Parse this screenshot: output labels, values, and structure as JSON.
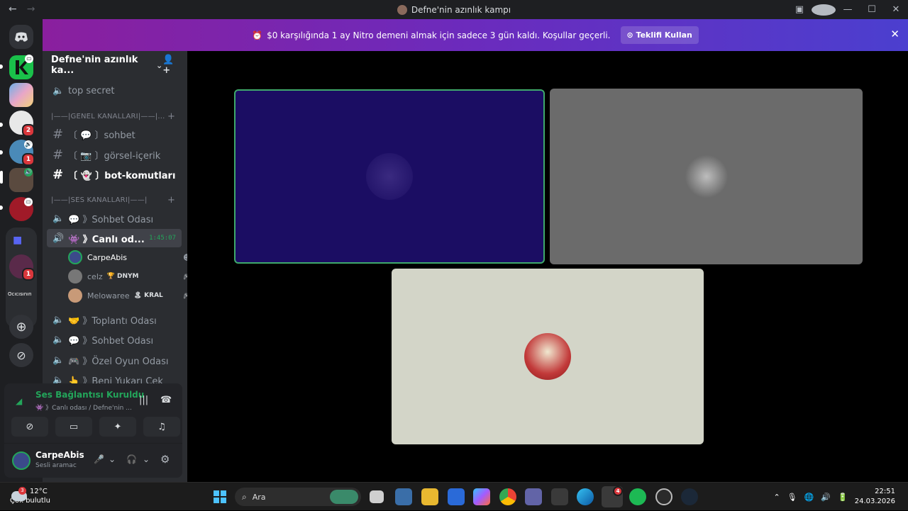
{
  "titlebar": {
    "title": "Defne'nin azınlık kampı",
    "back": "←",
    "forward": "→",
    "help": "?",
    "minimize": "—",
    "maximize": "☐",
    "close": "✕"
  },
  "rail": {
    "badges": {
      "s3": "2",
      "s4": "1",
      "folder": "1"
    },
    "folder_label": "Ocıcısının"
  },
  "nitro": {
    "icon": "⏰",
    "text": "$0 karşılığında 1 ay Nitro demeni almak için sadece 3 gün kaldı. Koşullar geçerli.",
    "button": "Teklifi Kullan",
    "close": "✕"
  },
  "server": {
    "name": "Defne'nin azınlık ka..."
  },
  "channels": {
    "top": "top secret",
    "cat1": "|——|GENEL KANALLARI|——|...",
    "text": [
      {
        "label": "〔 💬 〕sohbet"
      },
      {
        "label": "〔 📷 〕görsel-içerik"
      },
      {
        "label": "〔 👻 〕bot-komutları"
      }
    ],
    "cat2": "|——|SES KANALLARI|——|",
    "voice1": "💬 》Sohbet Odası",
    "live": {
      "label": "👾 》Canlı od...",
      "time": "1:45:07"
    },
    "members": [
      {
        "name": "CarpeAbis",
        "tag": ""
      },
      {
        "name": "celz",
        "tag": "🏆 DNYM"
      },
      {
        "name": "Melowaree",
        "tag": "🏝 KRAL"
      }
    ],
    "voice": [
      "🤝 》Toplantı Odası",
      "💬 》Sohbet Odası",
      "🎮 》Özel Oyun Odası",
      "👆 》Beni Yukarı Çek"
    ]
  },
  "voice_panel": {
    "status": "Ses Bağlantısı Kuruldu",
    "sub": "👾 》Canlı odası / Defne'nin ...",
    "user": "CarpeAbis",
    "user_status": "Sesli aramac"
  },
  "taskbar": {
    "weather_temp": "12°C",
    "weather_desc": "Çok bulutlu",
    "weather_badge": "3",
    "search": "Ara",
    "discord_badge": "4",
    "time": "22:51",
    "date": "24.03.2026"
  },
  "colors": {
    "accent": "#23a55a",
    "nitro_start": "#8a1f9e",
    "nitro_end": "#4b3fcf",
    "tile1": "#1b0d63",
    "tile2": "#6b6b6b",
    "tile3": "#d3d5c8"
  }
}
